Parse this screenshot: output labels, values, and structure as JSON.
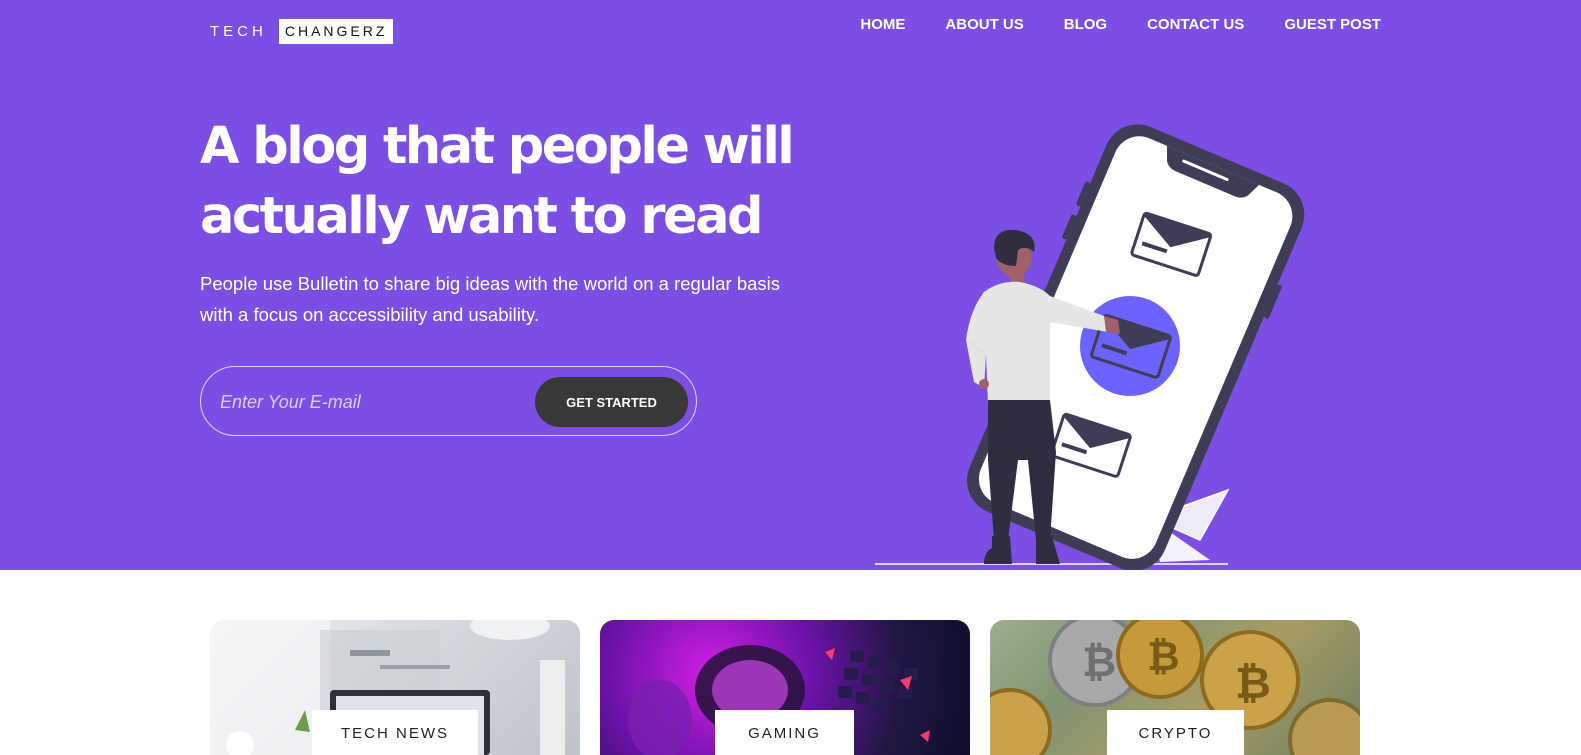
{
  "brand": {
    "logo_part1": "TECH",
    "logo_part2": "CHANGERZ"
  },
  "nav": {
    "items": [
      {
        "label": "HOME"
      },
      {
        "label": "ABOUT US"
      },
      {
        "label": "BLOG"
      },
      {
        "label": "CONTACT US"
      },
      {
        "label": "GUEST POST"
      }
    ]
  },
  "hero": {
    "headline_line1": "A blog that people will",
    "headline_line2": "actually want to read",
    "subtext": "People use Bulletin to share big ideas with the world on a regular basis with a focus on accessibility and usability.",
    "email_placeholder": "Enter Your E-mail",
    "email_value": "",
    "cta_label": "GET STARTED",
    "illustration": "person-tapping-phone-email-illustration"
  },
  "categories": [
    {
      "label": "TECH NEWS",
      "image": "laptop-desk-photo"
    },
    {
      "label": "GAMING",
      "image": "gaming-headset-keyboard-photo"
    },
    {
      "label": "CRYPTO",
      "image": "bitcoin-coins-dollars-photo"
    }
  ],
  "colors": {
    "hero_bg": "#7b4fe3",
    "cta_bg": "#3a3836",
    "accent_circle": "#6c63ff",
    "text_light": "#ffffff"
  }
}
